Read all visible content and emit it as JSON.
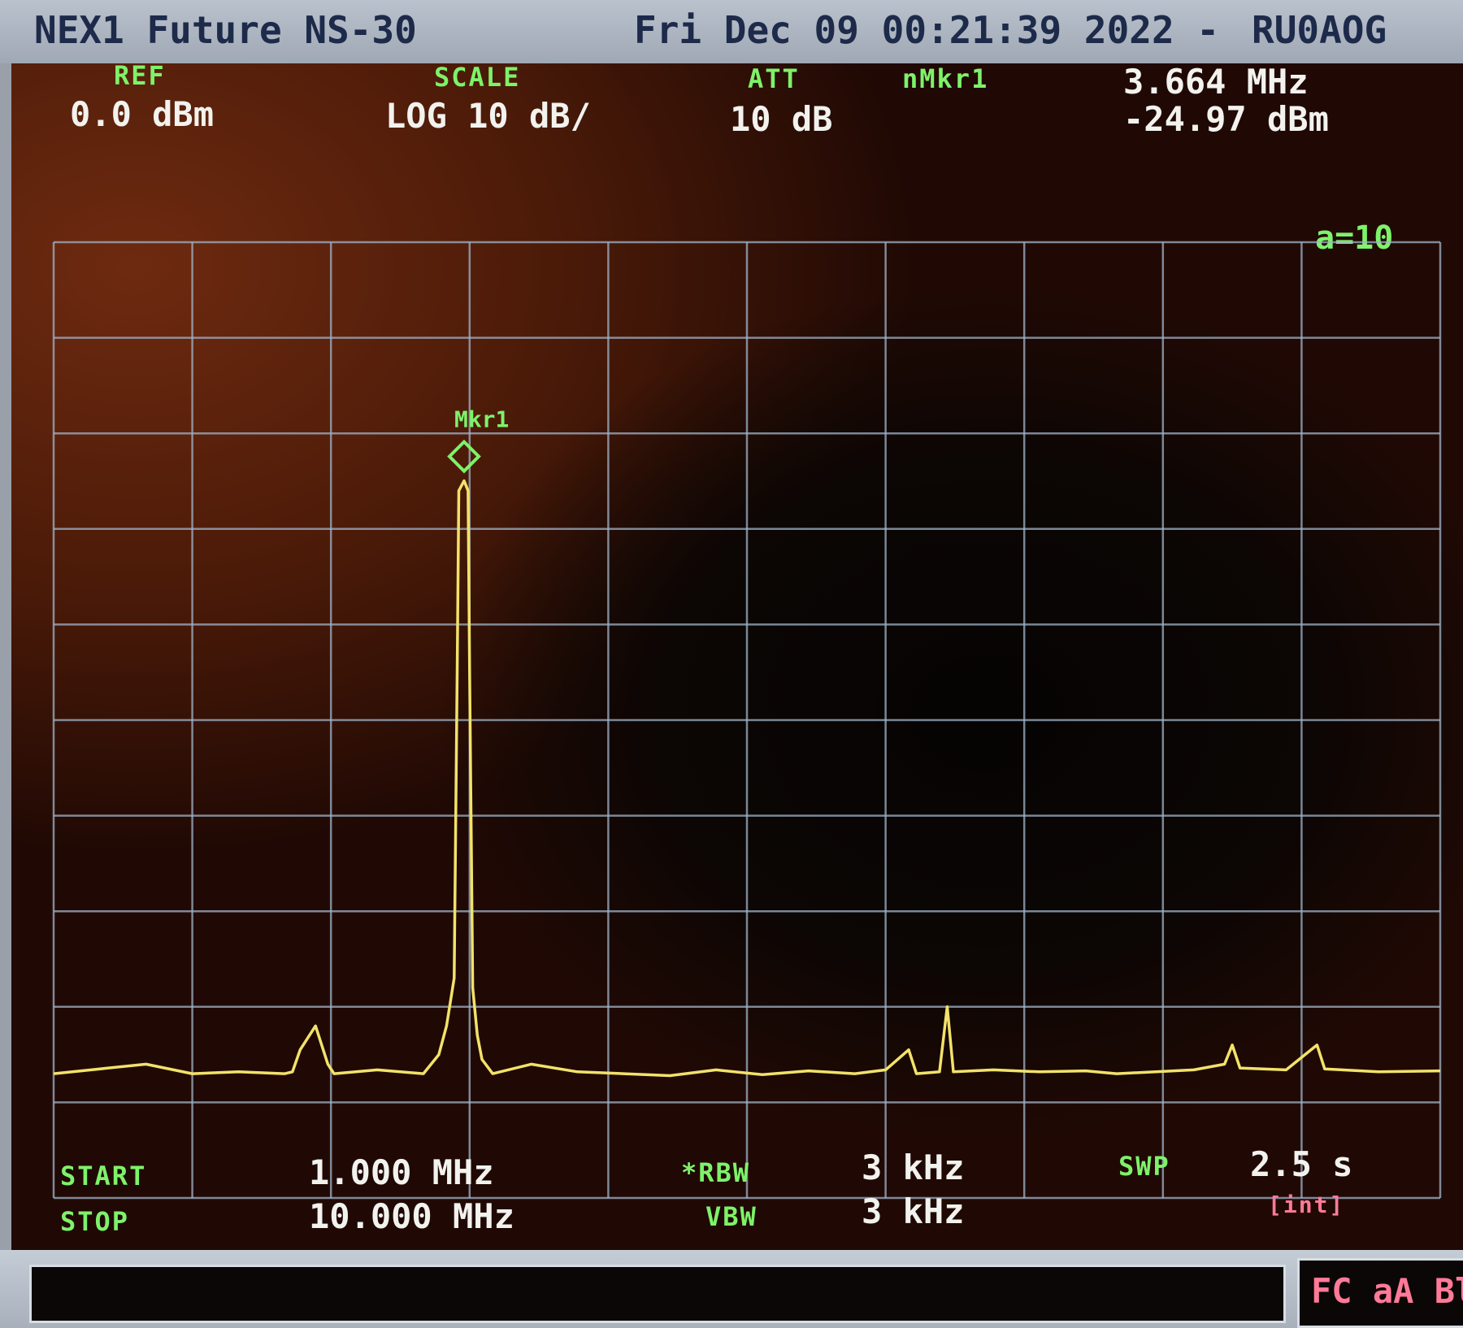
{
  "titlebar": {
    "instrument": "NEX1 Future NS-30",
    "datetime": "Fri Dec 09 00:21:39 2022 -",
    "callsign": "RU0AOG"
  },
  "header": {
    "ref_label": "REF",
    "ref_value": "0.0 dBm",
    "scale_label": "SCALE",
    "scale_value": "LOG 10 dB/",
    "att_label": "ATT",
    "att_value": "10 dB",
    "marker_label": "nMkr1",
    "marker_freq": "3.664 MHz",
    "marker_level": "-24.97 dBm",
    "avg_label": "a=10"
  },
  "footer": {
    "start_label": "START",
    "start_value": "1.000 MHz",
    "stop_label": "STOP",
    "stop_value": "10.000 MHz",
    "rbw_label": "*RBW",
    "rbw_value": "3 kHz",
    "vbw_label": "VBW",
    "vbw_value": "3 kHz",
    "swp_label": "SWP",
    "swp_value": "2.5 s",
    "swp_mode": "[int]"
  },
  "statusbar": {
    "flags": "FC aA Bl"
  },
  "colors": {
    "trace": "#f2e26a",
    "grid": "#9fb3c8",
    "marker": "#7ef26a",
    "label_green": "#7ef26a",
    "label_pink": "#ff7a98"
  },
  "chart_data": {
    "type": "line",
    "title": "",
    "xlabel": "",
    "ylabel": "",
    "xunit": "MHz",
    "yunit": "dBm",
    "xlim": [
      1.0,
      10.0
    ],
    "ylim": [
      -100,
      0
    ],
    "grid": true,
    "x_divisions": 10,
    "y_divisions": 10,
    "noise_floor": -87,
    "marker": {
      "name": "Mkr1",
      "x": 3.664,
      "y": -24.97
    },
    "series": [
      {
        "values": [
          [
            1.0,
            -87
          ],
          [
            1.3,
            -86.5
          ],
          [
            1.6,
            -86
          ],
          [
            1.9,
            -87
          ],
          [
            2.2,
            -86.8
          ],
          [
            2.5,
            -87
          ],
          [
            2.55,
            -86.8
          ],
          [
            2.6,
            -84.5
          ],
          [
            2.7,
            -82
          ],
          [
            2.78,
            -86
          ],
          [
            2.82,
            -87
          ],
          [
            3.1,
            -86.6
          ],
          [
            3.4,
            -87
          ],
          [
            3.5,
            -85
          ],
          [
            3.55,
            -82
          ],
          [
            3.6,
            -77
          ],
          [
            3.62,
            -44
          ],
          [
            3.63,
            -26
          ],
          [
            3.664,
            -24.97
          ],
          [
            3.69,
            -26
          ],
          [
            3.7,
            -45
          ],
          [
            3.72,
            -78
          ],
          [
            3.75,
            -83
          ],
          [
            3.78,
            -85.5
          ],
          [
            3.85,
            -87
          ],
          [
            4.1,
            -86
          ],
          [
            4.4,
            -86.8
          ],
          [
            4.7,
            -87
          ],
          [
            5.0,
            -87.2
          ],
          [
            5.3,
            -86.6
          ],
          [
            5.6,
            -87.1
          ],
          [
            5.9,
            -86.7
          ],
          [
            6.2,
            -87
          ],
          [
            6.4,
            -86.6
          ],
          [
            6.55,
            -84.5
          ],
          [
            6.6,
            -87
          ],
          [
            6.75,
            -86.8
          ],
          [
            6.8,
            -80
          ],
          [
            6.84,
            -86.8
          ],
          [
            7.1,
            -86.6
          ],
          [
            7.4,
            -86.8
          ],
          [
            7.7,
            -86.7
          ],
          [
            7.9,
            -87
          ],
          [
            8.4,
            -86.6
          ],
          [
            8.6,
            -86
          ],
          [
            8.65,
            -84
          ],
          [
            8.7,
            -86.4
          ],
          [
            9.0,
            -86.6
          ],
          [
            9.2,
            -84
          ],
          [
            9.25,
            -86.5
          ],
          [
            9.6,
            -86.8
          ],
          [
            10.0,
            -86.7
          ]
        ]
      }
    ]
  }
}
